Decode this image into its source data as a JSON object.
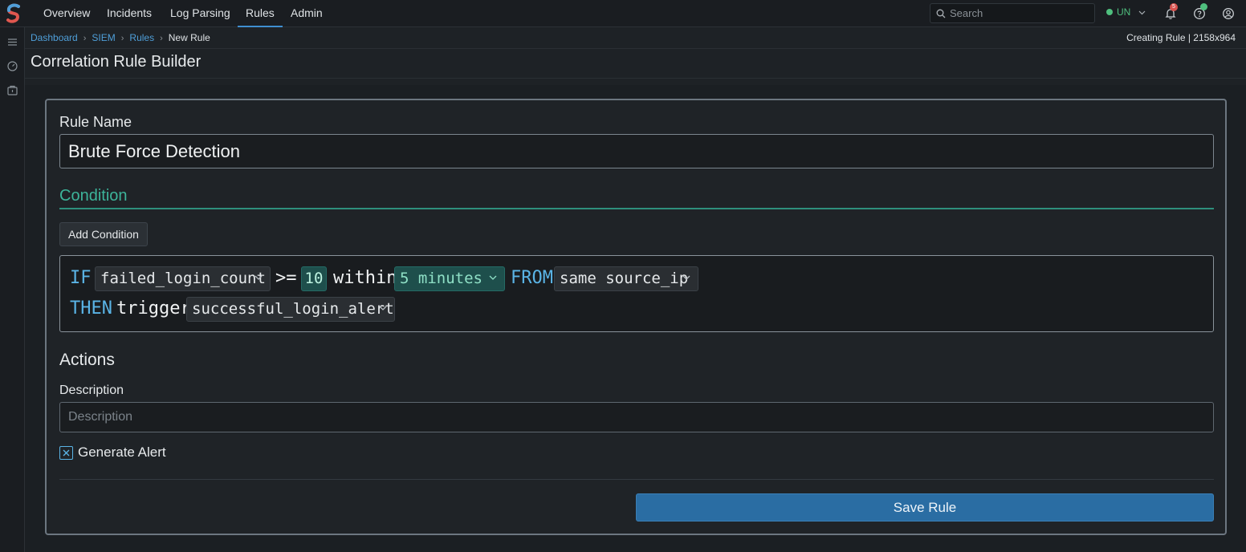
{
  "nav": {
    "items": [
      {
        "label": "Overview"
      },
      {
        "label": "Incidents"
      },
      {
        "label": "Log Parsing"
      },
      {
        "label": "Rules",
        "active": true
      },
      {
        "label": "Admin"
      }
    ],
    "search_placeholder": "Search",
    "status_label": "UN",
    "notifications_count": "5",
    "icons": [
      "search-icon",
      "bell-icon",
      "help-icon",
      "user-icon",
      "chevron-down-icon"
    ]
  },
  "rail": {
    "icons": [
      "list-icon",
      "dashboard-icon",
      "case-icon"
    ]
  },
  "breadcrumb": {
    "items": [
      "Dashboard",
      "SIEM",
      "Rules"
    ],
    "current": "New Rule"
  },
  "header_info": "Creating Rule | 2158x964",
  "page_title": "Correlation Rule Builder",
  "form": {
    "rule_name_label": "Rule Name",
    "rule_name_value": "Brute Force Detection",
    "condition_title": "Condition",
    "add_condition_label": "Add Condition",
    "condition": {
      "if_keyword": "IF",
      "field": "failed_login_count",
      "operator": ">=",
      "threshold": "10",
      "within_keyword": "within",
      "window": "5 minutes",
      "from_keyword": "FROM",
      "source": "same source_ip",
      "then_keyword": "THEN",
      "trigger_keyword": "trigger",
      "action": "successful_login_alert"
    },
    "actions_title": "Actions",
    "description_label": "Description",
    "description_placeholder": "Description",
    "description_value": "",
    "generate_alert_label": "Generate Alert",
    "generate_alert_checked": true,
    "save_label": "Save Rule"
  },
  "colors": {
    "accent_blue": "#3f8fd0",
    "accent_teal": "#3db49a",
    "save_button": "#2a6da3",
    "background": "#1e2226"
  }
}
